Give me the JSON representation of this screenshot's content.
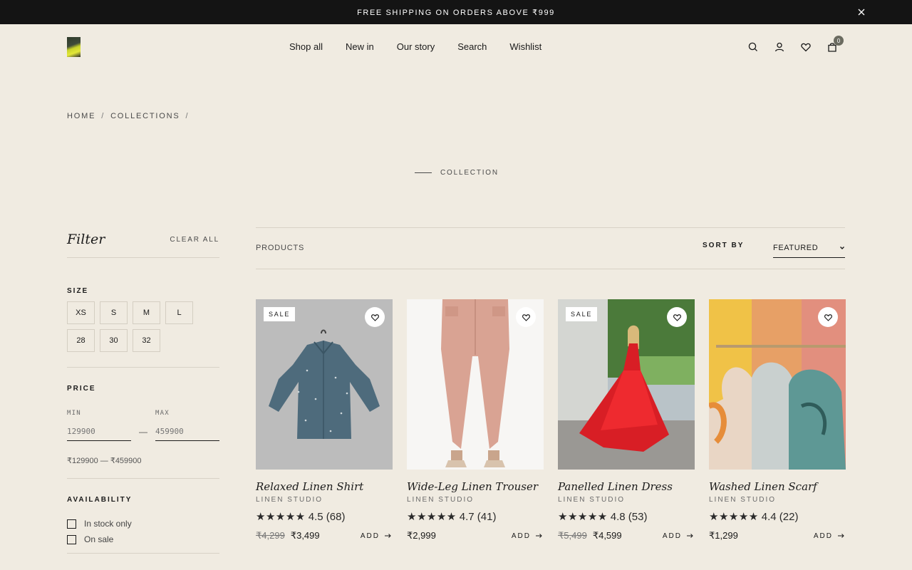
{
  "announcement": {
    "text": "FREE SHIPPING ON ORDERS ABOVE ₹999"
  },
  "nav": [
    "Shop all",
    "New in",
    "Our story",
    "Search",
    "Wishlist"
  ],
  "header": {
    "cart_count": "0"
  },
  "breadcrumb": {
    "home": "HOME",
    "collections": "COLLECTIONS",
    "sep": "/"
  },
  "collection": {
    "eyebrow": "COLLECTION"
  },
  "filter": {
    "title": "Filter",
    "clear_all": "CLEAR ALL",
    "size_title": "SIZE",
    "sizes": [
      "XS",
      "S",
      "M",
      "L",
      "28",
      "30",
      "32"
    ],
    "price_title": "PRICE",
    "min_label": "MIN",
    "max_label": "MAX",
    "min_placeholder": "129900",
    "max_placeholder": "459900",
    "dash": "—",
    "range_text": "₹129900 — ₹459900",
    "availability_title": "AVAILABILITY",
    "in_stock": "In stock only",
    "on_sale": "On sale"
  },
  "toolbar": {
    "products_label": "PRODUCTS",
    "sort_label": "SORT BY",
    "sort_value": "FEATURED"
  },
  "products": [
    {
      "name": "Relaxed Linen Shirt",
      "brand": "LINEN STUDIO",
      "rating": "4.5",
      "reviews": "(68)",
      "old_price": "₹4,299",
      "price": "₹3,499",
      "sale": "SALE",
      "add": "ADD"
    },
    {
      "name": "Wide-Leg Linen Trouser",
      "brand": "LINEN STUDIO",
      "rating": "4.7",
      "reviews": "(41)",
      "old_price": "",
      "price": "₹2,999",
      "sale": "",
      "add": "ADD"
    },
    {
      "name": "Panelled Linen Dress",
      "brand": "LINEN STUDIO",
      "rating": "4.8",
      "reviews": "(53)",
      "old_price": "₹5,499",
      "price": "₹4,599",
      "sale": "SALE",
      "add": "ADD"
    },
    {
      "name": "Washed Linen Scarf",
      "brand": "LINEN STUDIO",
      "rating": "4.4",
      "reviews": "(22)",
      "old_price": "",
      "price": "₹1,299",
      "sale": "",
      "add": "ADD"
    }
  ],
  "stars": "★★★★★",
  "colors": {
    "announcement_bg": "#141414",
    "page_bg": "#f0ebe1",
    "text": "#1a1a1a",
    "badge": "#6b6b60"
  }
}
